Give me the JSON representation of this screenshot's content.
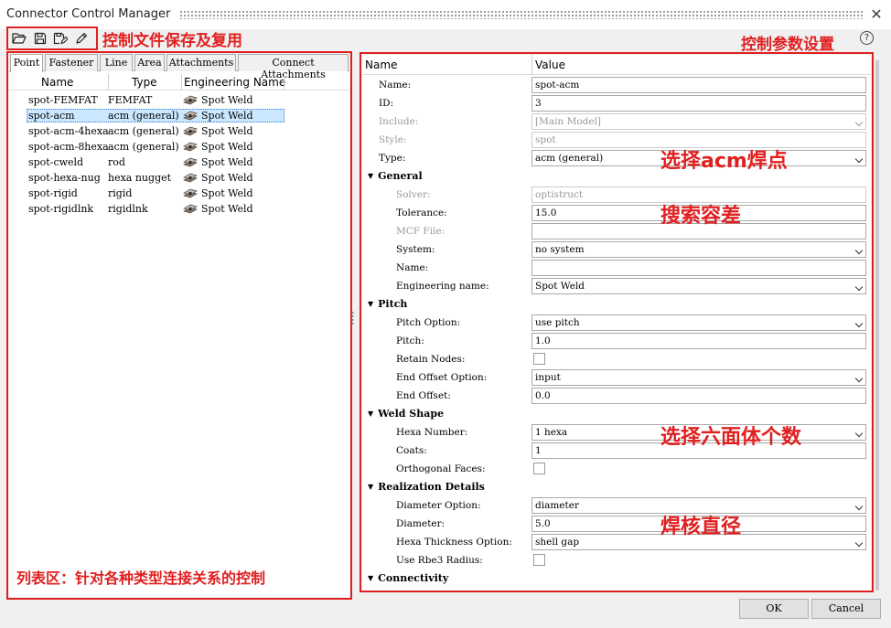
{
  "window": {
    "title": "Connector Control Manager"
  },
  "annotations": {
    "toolbar": "控制文件保存及复用",
    "params": "控制参数设置",
    "acm": "选择acm焊点",
    "tolerance": "搜索容差",
    "hexa": "选择六面体个数",
    "diameter": "焊核直径",
    "list": "列表区：针对各种类型连接关系的控制"
  },
  "tabs": [
    "Point",
    "Fastener",
    "Line",
    "Area",
    "Attachments",
    "Connect Attachments"
  ],
  "list": {
    "columns": [
      "Name",
      "Type",
      "Engineering Name"
    ],
    "rows": [
      {
        "name": "spot-FEMFAT",
        "type": "FEMFAT",
        "eng": "Spot Weld"
      },
      {
        "name": "spot-acm",
        "type": "acm (general)",
        "eng": "Spot Weld"
      },
      {
        "name": "spot-acm-4hexa",
        "type": "acm (general)",
        "eng": "Spot Weld"
      },
      {
        "name": "spot-acm-8hexa",
        "type": "acm (general)",
        "eng": "Spot Weld"
      },
      {
        "name": "spot-cweld",
        "type": "rod",
        "eng": "Spot Weld"
      },
      {
        "name": "spot-hexa-nug",
        "type": "hexa nugget",
        "eng": "Spot Weld"
      },
      {
        "name": "spot-rigid",
        "type": "rigid",
        "eng": "Spot Weld"
      },
      {
        "name": "spot-rigidlnk",
        "type": "rigidlnk",
        "eng": "Spot Weld"
      }
    ]
  },
  "props": {
    "columns": [
      "Name",
      "Value"
    ],
    "rows": [
      {
        "kind": "field",
        "label": "Name:",
        "value": "spot-acm",
        "indent": 1
      },
      {
        "kind": "field",
        "label": "ID:",
        "value": "3",
        "indent": 1
      },
      {
        "kind": "combo",
        "label": "Include:",
        "value": "[Main Model]",
        "indent": 1,
        "disabled": true
      },
      {
        "kind": "field",
        "label": "Style:",
        "value": "spot",
        "indent": 1,
        "disabled": true
      },
      {
        "kind": "combo",
        "label": "Type:",
        "value": "acm (general)",
        "indent": 1
      },
      {
        "kind": "group",
        "label": "General"
      },
      {
        "kind": "field",
        "label": "Solver:",
        "value": "optistruct",
        "indent": 2,
        "disabled": true
      },
      {
        "kind": "field",
        "label": "Tolerance:",
        "value": "15.0",
        "indent": 2
      },
      {
        "kind": "field",
        "label": "MCF File:",
        "value": "",
        "indent": 2,
        "disabledLabel": true
      },
      {
        "kind": "combo",
        "label": "System:",
        "value": "no system",
        "indent": 2
      },
      {
        "kind": "field",
        "label": "Name:",
        "value": "",
        "indent": 2
      },
      {
        "kind": "combo",
        "label": "Engineering name:",
        "value": "Spot Weld",
        "indent": 2
      },
      {
        "kind": "group",
        "label": "Pitch"
      },
      {
        "kind": "combo",
        "label": "Pitch Option:",
        "value": "use pitch",
        "indent": 2
      },
      {
        "kind": "field",
        "label": "Pitch:",
        "value": "1.0",
        "indent": 2
      },
      {
        "kind": "check",
        "label": "Retain Nodes:",
        "indent": 2
      },
      {
        "kind": "combo",
        "label": "End Offset Option:",
        "value": "input",
        "indent": 2
      },
      {
        "kind": "field",
        "label": "End Offset:",
        "value": "0.0",
        "indent": 2
      },
      {
        "kind": "group",
        "label": "Weld Shape"
      },
      {
        "kind": "combo",
        "label": "Hexa Number:",
        "value": "1 hexa",
        "indent": 2
      },
      {
        "kind": "field",
        "label": "Coats:",
        "value": "1",
        "indent": 2
      },
      {
        "kind": "check",
        "label": "Orthogonal Faces:",
        "indent": 2
      },
      {
        "kind": "group",
        "label": "Realization Details"
      },
      {
        "kind": "combo",
        "label": "Diameter Option:",
        "value": "diameter",
        "indent": 2
      },
      {
        "kind": "field",
        "label": "Diameter:",
        "value": "5.0",
        "indent": 2
      },
      {
        "kind": "combo",
        "label": "Hexa Thickness Option:",
        "value": "shell gap",
        "indent": 2
      },
      {
        "kind": "check",
        "label": "Use Rbe3 Radius:",
        "indent": 2
      },
      {
        "kind": "group",
        "label": "Connectivity"
      }
    ]
  },
  "buttons": {
    "ok": "OK",
    "cancel": "Cancel"
  }
}
